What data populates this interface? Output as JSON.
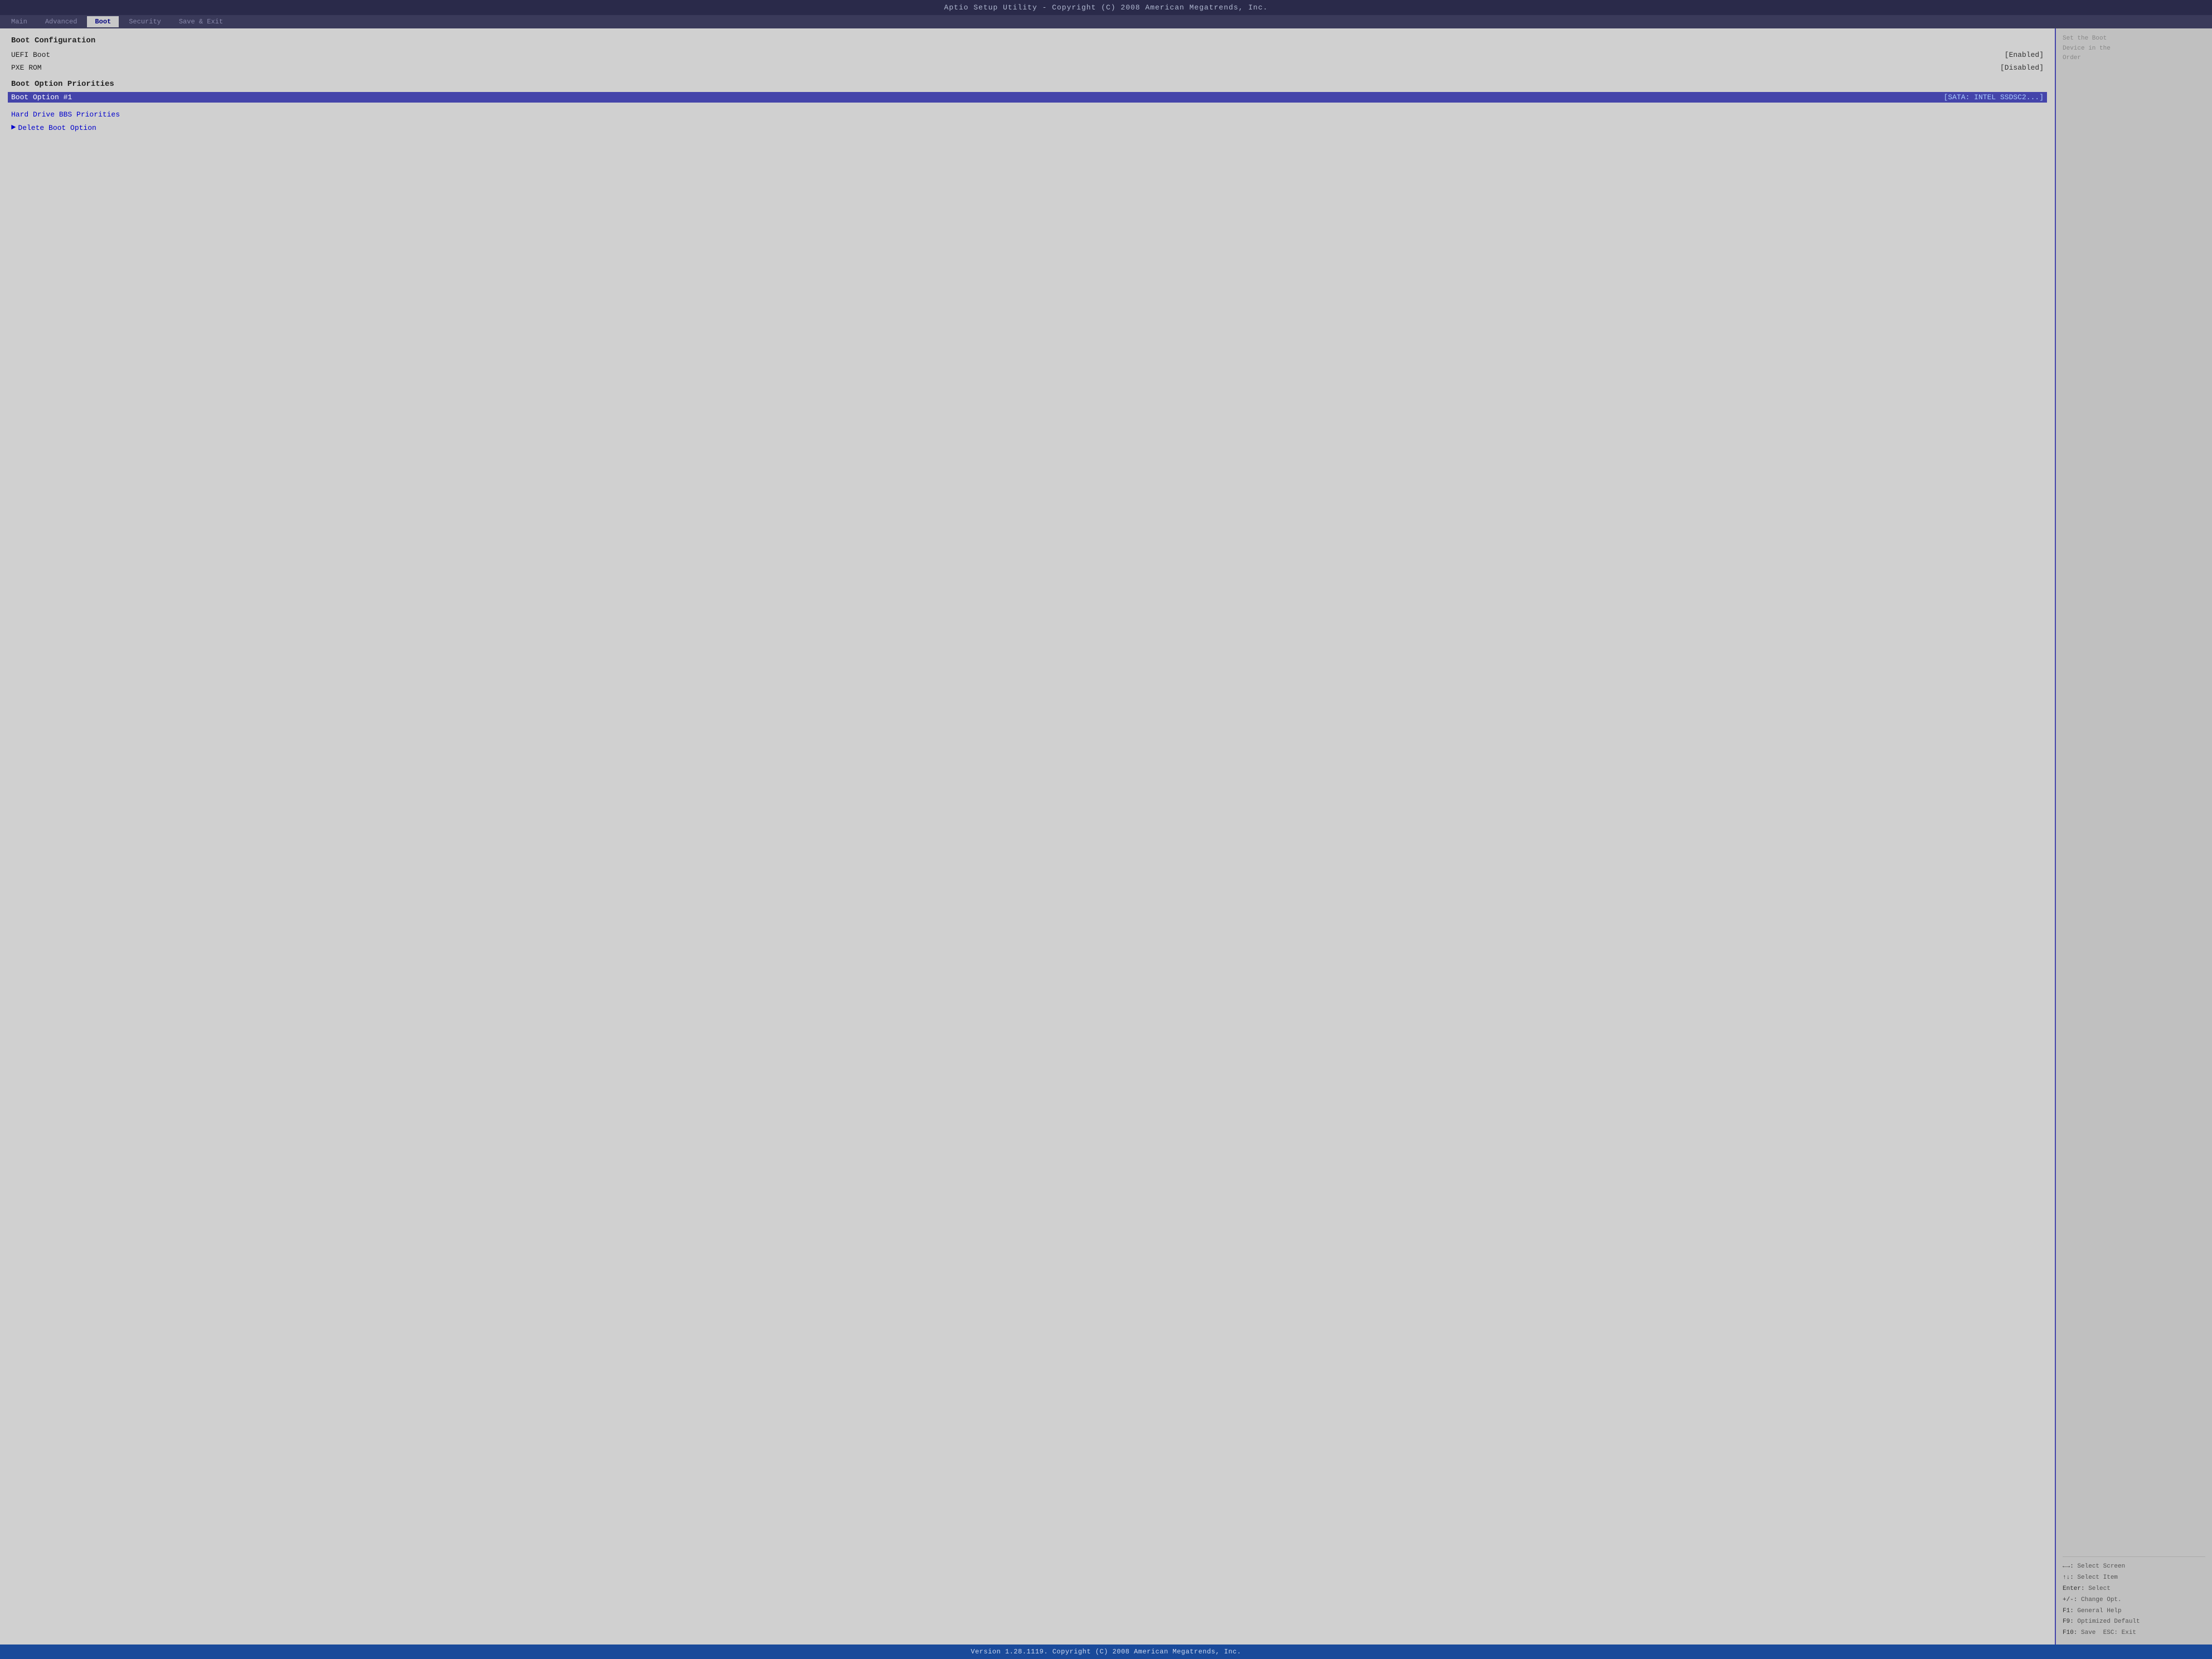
{
  "titleBar": {
    "text": "Aptio Setup Utility - Copyright (C) 2008 American Megatrends, Inc."
  },
  "navTabs": [
    {
      "id": "main",
      "label": "Main",
      "active": false
    },
    {
      "id": "advanced",
      "label": "Advanced",
      "active": false
    },
    {
      "id": "boot",
      "label": "Boot",
      "active": true
    },
    {
      "id": "security",
      "label": "Security",
      "active": false
    },
    {
      "id": "save_exit",
      "label": "Save & Exit",
      "active": false
    }
  ],
  "menu": {
    "sections": [
      {
        "header": "Boot Configuration",
        "items": [
          {
            "label": "UEFI Boot",
            "value": "[Enabled]"
          },
          {
            "label": "PXE ROM",
            "value": "[Disabled]"
          }
        ]
      },
      {
        "header": "Boot Option Priorities",
        "items": [
          {
            "label": "Boot Option #1",
            "value": "[SATA: INTEL SSDSC2...]",
            "highlighted": true
          }
        ]
      },
      {
        "header": "",
        "items": [
          {
            "label": "Hard Drive BBS Priorities",
            "value": "",
            "arrow": false
          },
          {
            "label": "Delete Boot Option",
            "value": "",
            "arrow": true
          }
        ]
      }
    ]
  },
  "helpPanel": {
    "topText": "Set the Boot\nDevice in the\nOrder",
    "keyHelp": [
      {
        "key": "←→:",
        "desc": "Select Screen"
      },
      {
        "key": "↑↓:",
        "desc": "Select Item"
      },
      {
        "key": "Enter:",
        "desc": "Select"
      },
      {
        "key": "+/-:",
        "desc": "Change Opt."
      },
      {
        "key": "F1:",
        "desc": "General Help"
      },
      {
        "key": "F9:",
        "desc": "Optimized Default"
      },
      {
        "key": "F10:",
        "desc": "Save  ESC: Exit"
      }
    ]
  },
  "statusBar": {
    "text": "Version 1.28.1119. Copyright (C) 2008 American Megatrends, Inc."
  }
}
